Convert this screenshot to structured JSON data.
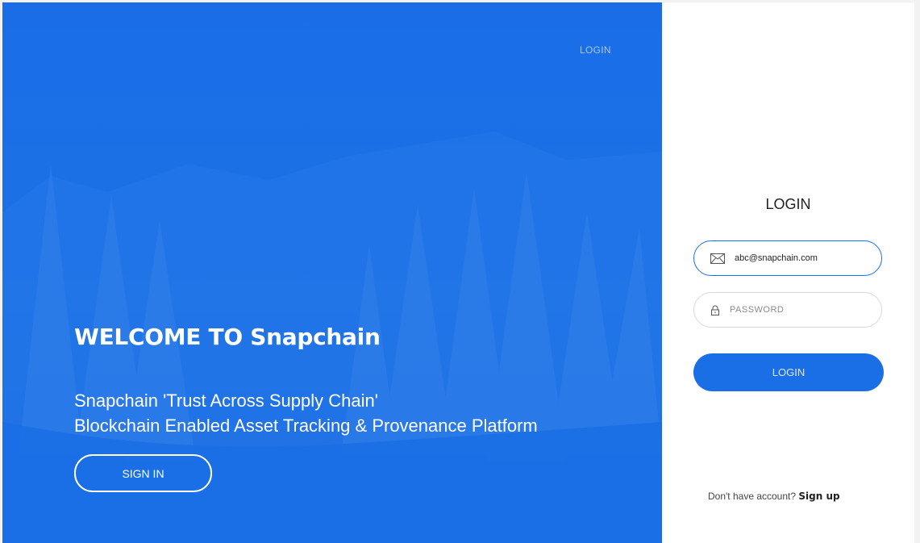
{
  "hero": {
    "nav_login": "LOGIN",
    "welcome": "WELCOME TO Snapchain",
    "tagline_line1": "Snapchain 'Trust Across Supply Chain'",
    "tagline_line2": "Blockchain Enabled Asset Tracking & Provenance Platform",
    "signin_label": "SIGN IN",
    "accent_color": "#1a6fe6"
  },
  "login_panel": {
    "title": "LOGIN",
    "email": {
      "value": "abc@snapchain.com",
      "icon": "mail-icon"
    },
    "password": {
      "placeholder": "PASSWORD",
      "value": "",
      "icon": "lock-icon"
    },
    "submit_label": "LOGIN",
    "signup_prompt": "Don't have account?",
    "signup_link": "Sign up"
  }
}
